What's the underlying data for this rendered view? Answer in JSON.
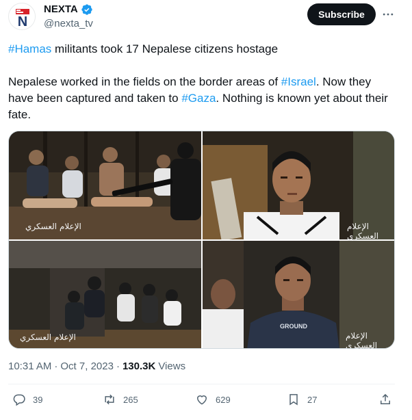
{
  "author": {
    "display_name": "NEXTA",
    "handle": "@nexta_tv",
    "avatar_text": "N",
    "verified": true
  },
  "header": {
    "subscribe_label": "Subscribe",
    "more_icon": "more-dots-icon"
  },
  "tweet": {
    "line1_hashtag": "#Hamas",
    "line1_rest": " militants took 17 Nepalese citizens hostage",
    "para2_part1": "Nepalese worked in the fields on the border areas of ",
    "para2_hashtag1": "#Israel",
    "para2_part2": ". Now they have been captured and taken to ",
    "para2_hashtag2": "#Gaza",
    "para2_part3": ". Nothing is known yet about their fate."
  },
  "media": {
    "watermark": "الإعلام العسكري",
    "images": [
      {
        "alt": "group of captives seated with armed militant"
      },
      {
        "alt": "young man in white shirt close-up"
      },
      {
        "alt": "captives crouched in dark tunnel"
      },
      {
        "alt": "young man in GROUND hoodie"
      }
    ],
    "hoodie_text": "GROUND"
  },
  "meta": {
    "time": "10:31 AM",
    "separator1": "·",
    "date": "Oct 7, 2023",
    "separator2": "·",
    "views_count": "130.3K",
    "views_label": "Views"
  },
  "actions": {
    "replies": "39",
    "retweets": "265",
    "likes": "629",
    "bookmarks": "27"
  },
  "colors": {
    "link": "#1d9bf0",
    "text": "#0f1419",
    "muted": "#536471",
    "verified": "#1d9bf0",
    "avatar_red": "#d8232a",
    "avatar_navy": "#1f3a6e"
  }
}
